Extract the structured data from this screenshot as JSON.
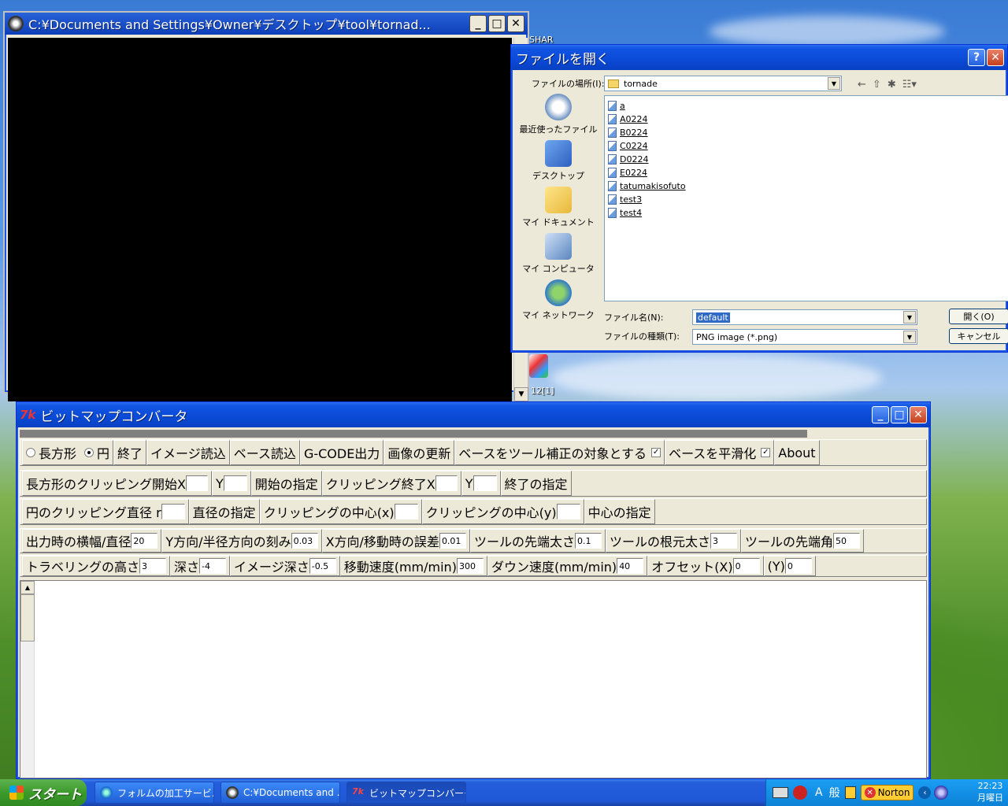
{
  "console": {
    "title": "C:¥Documents and Settings¥Owner¥デスクトップ¥tool¥tornad..."
  },
  "dialog": {
    "title": "ファイルを開く",
    "help_label": "?",
    "lookin_label": "ファイルの場所(I):",
    "lookin_value": "tornade",
    "places": [
      {
        "label": "最近使ったファイル"
      },
      {
        "label": "デスクトップ"
      },
      {
        "label": "マイ ドキュメント"
      },
      {
        "label": "マイ コンピュータ"
      },
      {
        "label": "マイ ネットワーク"
      }
    ],
    "files": [
      "a",
      "A0224",
      "B0224",
      "C0224",
      "D0224",
      "E0224",
      "tatumakisofuto",
      "test3",
      "test4"
    ],
    "filename_label": "ファイル名(N):",
    "filename_value": "default",
    "filetype_label": "ファイルの種類(T):",
    "filetype_value": "PNG image (*.png)",
    "open_label": "開く(O)",
    "cancel_label": "キャンセル"
  },
  "app": {
    "title": "ビットマップコンバータ",
    "row1": {
      "rect": "長方形",
      "circle": "円",
      "quit": "終了",
      "load_image": "イメージ読込",
      "load_base": "ベース読込",
      "gcode": "G-CODE出力",
      "refresh": "画像の更新",
      "base_tool": "ベースをツール補正の対象とする",
      "base_smooth": "ベースを平滑化",
      "about": "About",
      "check_mark": "✓"
    },
    "row2": {
      "rect_start_x": "長方形のクリッピング開始X",
      "y1": "Y",
      "set_start": "開始の指定",
      "clip_end_x": "クリッピング終了X",
      "y2": "Y",
      "set_end": "終了の指定"
    },
    "row3": {
      "circle_diam": "円のクリッピング直径 r",
      "set_diam": "直径の指定",
      "center_x": "クリッピングの中心(x)",
      "center_y": "クリッピングの中心(y)",
      "set_center": "中心の指定"
    },
    "row4": {
      "out_width_label": "出力時の横幅/直径",
      "out_width": "20",
      "ystep_label": "Y方向/半径方向の刻み",
      "ystep": "0.03",
      "xerr_label": "X方向/移動時の誤差",
      "xerr": "0.01",
      "tip_label": "ツールの先端太さ",
      "tip": "0.1",
      "root_label": "ツールの根元太さ",
      "root": "3",
      "angle_label": "ツールの先端角",
      "angle": "50"
    },
    "row5": {
      "travel_label": "トラベリングの高さ",
      "travel": "3",
      "depth_label": "深さ",
      "depth": "-4",
      "imgdepth_label": "イメージ深さ",
      "imgdepth": "-0.5",
      "speed_label": "移動速度(mm/min)",
      "speed": "300",
      "down_label": "ダウン速度(mm/min)",
      "down": "40",
      "offx_label": "オフセット(X)",
      "offx": "0",
      "offy_label": "(Y)",
      "offy": "0"
    }
  },
  "taskbar": {
    "start": "スタート",
    "tasks": [
      "フォルムの加工サービ...",
      "C:¥Documents and ...",
      "ビットマップコンバータ"
    ],
    "ime1": "A",
    "ime2": "般",
    "norton": "Norton",
    "time": "22:23",
    "day": "月曜日"
  },
  "desktop": {
    "icon1": "SHAR",
    "icon2": "12[1]"
  }
}
